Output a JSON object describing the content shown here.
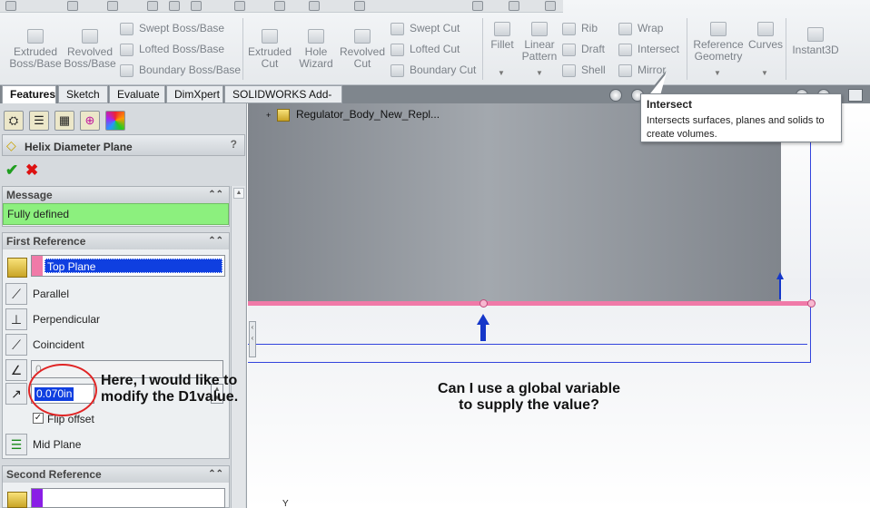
{
  "ribbon": {
    "buttons": [
      {
        "label": "Extruded\nBoss/Base"
      },
      {
        "label": "Revolved\nBoss/Base"
      },
      {
        "label": "Extruded\nCut"
      },
      {
        "label": "Hole\nWizard"
      },
      {
        "label": "Revolved\nCut"
      },
      {
        "label": "Fillet"
      },
      {
        "label": "Linear\nPattern"
      },
      {
        "label": "Reference\nGeometry"
      },
      {
        "label": "Curves"
      },
      {
        "label": "Instant3D"
      }
    ],
    "small": {
      "swept_boss": "Swept Boss/Base",
      "lofted_boss": "Lofted Boss/Base",
      "boundary_boss": "Boundary Boss/Base",
      "swept_cut": "Swept Cut",
      "lofted_cut": "Lofted Cut",
      "boundary_cut": "Boundary Cut",
      "rib": "Rib",
      "draft": "Draft",
      "shell": "Shell",
      "wrap": "Wrap",
      "intersect": "Intersect",
      "mirror": "Mirror"
    }
  },
  "tabs": [
    "Features",
    "Sketch",
    "Evaluate",
    "DimXpert",
    "SOLIDWORKS Add-Ins"
  ],
  "property_manager": {
    "title": "Helix Diameter Plane",
    "help": "?",
    "message_header": "Message",
    "message": "Fully defined",
    "first_ref_header": "First Reference",
    "first_ref_value": "Top Plane",
    "parallel": "Parallel",
    "perpendicular": "Perpendicular",
    "coincident": "Coincident",
    "angle_value": "0",
    "offset_value": "0.070in",
    "flip_offset": "Flip offset",
    "mid_plane": "Mid Plane",
    "second_ref_header": "Second Reference"
  },
  "tree": {
    "root": "Regulator_Body_New_Repl..."
  },
  "tooltip": {
    "title": "Intersect",
    "body": "Intersects surfaces, planes and solids to create volumes."
  },
  "annotations": {
    "note1_line1": "Here, I would like to",
    "note1_line2": "modify the D1value.",
    "note2_line1": "Can I use a global variable",
    "note2_line2": "to supply the value?"
  },
  "axis_label": "Y",
  "colors": {
    "message_bg": "#8cf07e",
    "plane_line": "#f07aa8",
    "selection": "#0f3fe0",
    "annotation_circle": "#e02424"
  }
}
